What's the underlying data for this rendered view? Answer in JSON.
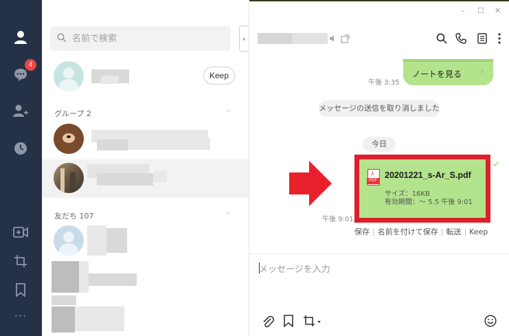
{
  "list": {
    "search_placeholder": "名前で検索",
    "collapse_glyph": "‹",
    "keep_label": "Keep",
    "groups_header": "グループ 2",
    "friends_header": "友だち 107",
    "chevron": "⌵"
  },
  "rail": {
    "unread_badge": "4",
    "more_glyph": "···"
  },
  "chat": {
    "window": {
      "minimize": "–",
      "maximize": "☐",
      "close": "✕"
    },
    "note_time": "午後 3:35",
    "note_label": "ノートを見る",
    "note_arrow": "›",
    "system_message": "メッセージの送信を取り消しました",
    "date_label": "今日",
    "file": {
      "name": "20201221_s-Ar_S.pdf",
      "size": "サイズ：16KB",
      "expiry": "有効期間：～ 5.5 午後 9:01",
      "type_tag": "PDF"
    },
    "file_time": "午後 9:01",
    "actions": [
      "保存",
      "名前を付けて保存",
      "転送",
      "Keep"
    ],
    "composer_placeholder": "メッセージを入力"
  },
  "colors": {
    "rail": "#253147",
    "bubble_green": "#b3e38d",
    "highlight_red": "#dd1f2b",
    "badge_red": "#e94848"
  }
}
